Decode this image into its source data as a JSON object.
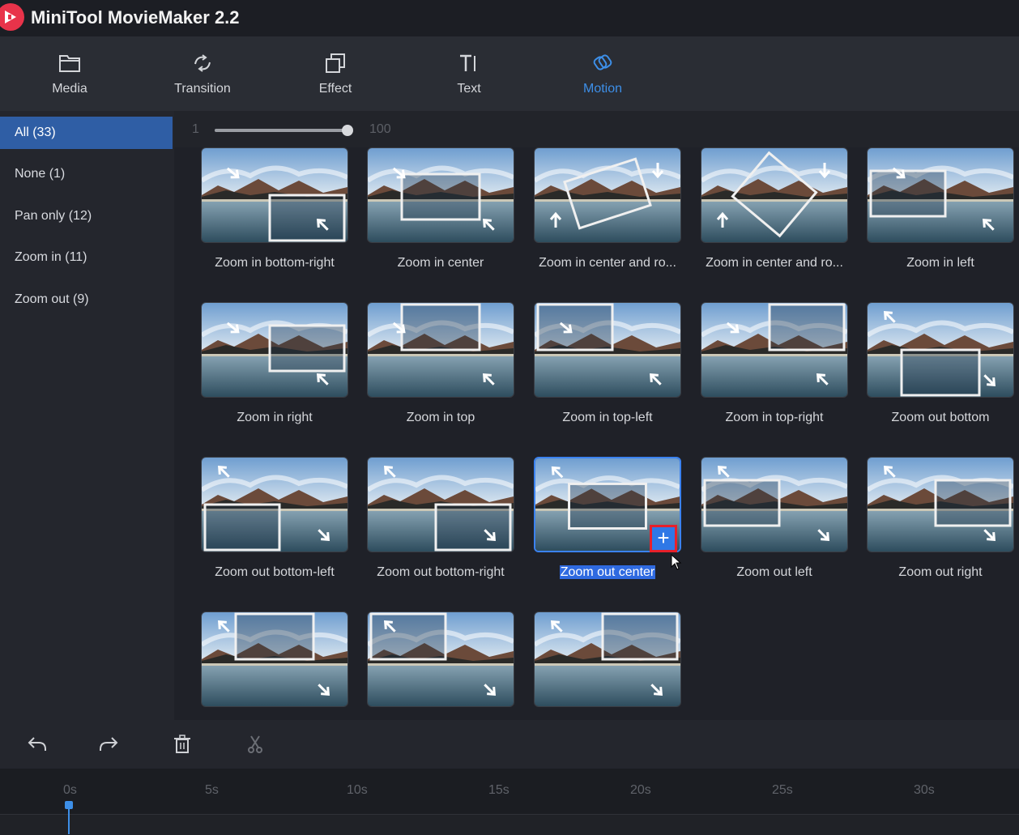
{
  "app": {
    "title": "MiniTool MovieMaker 2.2"
  },
  "toolbar": [
    {
      "label": "Media",
      "icon": "folder-icon"
    },
    {
      "label": "Transition",
      "icon": "transition-icon"
    },
    {
      "label": "Effect",
      "icon": "effect-icon"
    },
    {
      "label": "Text",
      "icon": "text-icon"
    },
    {
      "label": "Motion",
      "icon": "motion-icon",
      "active": true
    }
  ],
  "sidebar": [
    {
      "label": "All  (33)",
      "active": true
    },
    {
      "label": "None  (1)"
    },
    {
      "label": "Pan only  (12)"
    },
    {
      "label": "Zoom in  (11)"
    },
    {
      "label": "Zoom out  (9)"
    }
  ],
  "zoom_slider": {
    "min_label": "1",
    "max_label": "100",
    "value_fraction": 1.0
  },
  "effects": [
    {
      "name": "Zoom in bottom-right",
      "motion": "zoom-in",
      "frame": "bottom-right"
    },
    {
      "name": "Zoom in center",
      "motion": "zoom-in",
      "frame": "center"
    },
    {
      "name": "Zoom in center and ro...",
      "motion": "rotate",
      "frame": "center-rot"
    },
    {
      "name": "Zoom in center and ro...",
      "motion": "rotate",
      "frame": "center-rot2"
    },
    {
      "name": "Zoom in left",
      "motion": "zoom-in",
      "frame": "left"
    },
    {
      "name": "Zoom in right",
      "motion": "zoom-in",
      "frame": "right"
    },
    {
      "name": "Zoom in top",
      "motion": "zoom-in",
      "frame": "top"
    },
    {
      "name": "Zoom in top-left",
      "motion": "zoom-in",
      "frame": "top-left"
    },
    {
      "name": "Zoom in top-right",
      "motion": "zoom-in",
      "frame": "top-right"
    },
    {
      "name": "Zoom out bottom",
      "motion": "zoom-out",
      "frame": "bottom"
    },
    {
      "name": "Zoom out bottom-left",
      "motion": "zoom-out",
      "frame": "bottom-left"
    },
    {
      "name": "Zoom out bottom-right",
      "motion": "zoom-out",
      "frame": "bottom-right"
    },
    {
      "name": "Zoom out center",
      "motion": "zoom-out",
      "frame": "center",
      "selected": true
    },
    {
      "name": "Zoom out left",
      "motion": "zoom-out",
      "frame": "left"
    },
    {
      "name": "Zoom out right",
      "motion": "zoom-out",
      "frame": "right"
    },
    {
      "name": "",
      "motion": "zoom-out",
      "frame": "top"
    },
    {
      "name": "",
      "motion": "zoom-out",
      "frame": "top-left"
    },
    {
      "name": "",
      "motion": "zoom-out",
      "frame": "top-right"
    }
  ],
  "timeline": {
    "tools": [
      "undo-icon",
      "redo-icon",
      "delete-icon",
      "scissors-icon"
    ],
    "ticks": [
      "0s",
      "5s",
      "10s",
      "15s",
      "20s",
      "25s",
      "30s"
    ]
  },
  "colors": {
    "accent": "#3d8fe8",
    "highlight_box": "#e8202a",
    "sidebar_active": "#2f5ea5"
  }
}
